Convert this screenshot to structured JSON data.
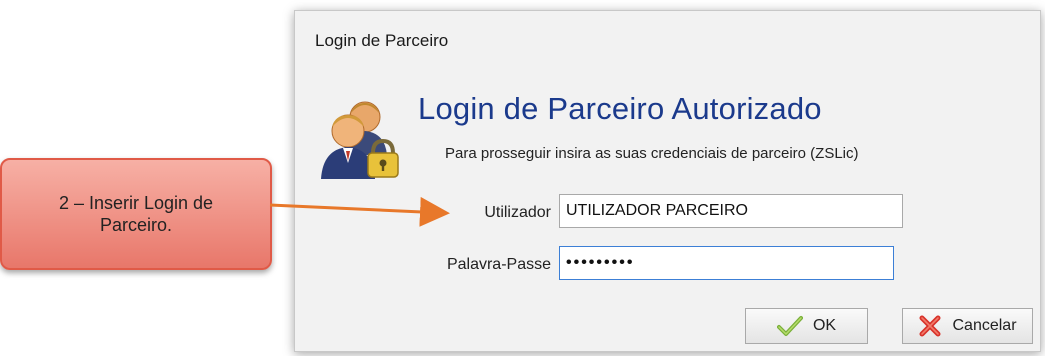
{
  "dialog": {
    "window_title": "Login de Parceiro",
    "header_title": "Login de Parceiro Autorizado",
    "header_subtitle": "Para prosseguir insira as suas credenciais de parceiro (ZSLic)",
    "header_icon": "users-lock-icon"
  },
  "form": {
    "username_label": "Utilizador",
    "username_value": "UTILIZADOR PARCEIRO",
    "password_label": "Palavra-Passe",
    "password_value": "•••••••••"
  },
  "buttons": {
    "ok_label": "OK",
    "ok_icon": "checkmark-icon",
    "cancel_label": "Cancelar",
    "cancel_icon": "x-icon"
  },
  "callout": {
    "line1": "2 – Inserir Login de",
    "line2": "Parceiro.",
    "fill_color": "#ec8a7c",
    "border_color": "#e05a47",
    "arrow_color": "#e8782a"
  }
}
